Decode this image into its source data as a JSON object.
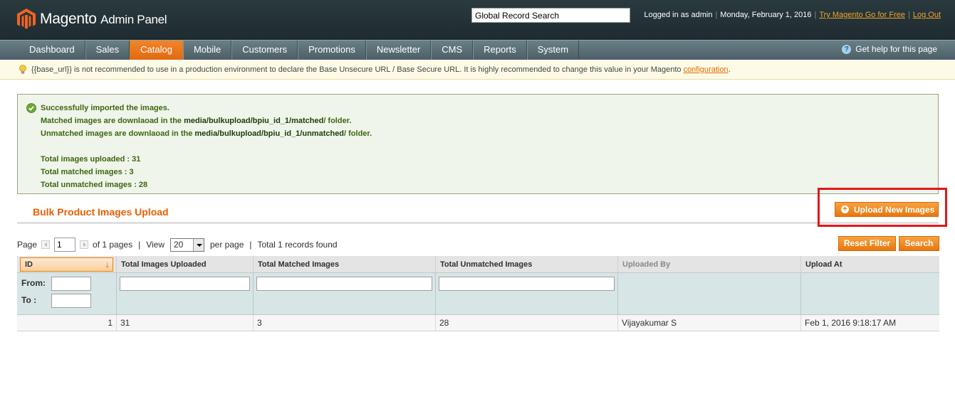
{
  "header": {
    "logo_main": "Magento",
    "logo_sub": "Admin Panel",
    "global_search_value": "Global Record Search",
    "logged_in": "Logged in as admin",
    "date": "Monday, February 1, 2016",
    "try_link": "Try Magento Go for Free",
    "logout_link": "Log Out"
  },
  "nav": {
    "items": [
      "Dashboard",
      "Sales",
      "Catalog",
      "Mobile",
      "Customers",
      "Promotions",
      "Newsletter",
      "CMS",
      "Reports",
      "System"
    ],
    "active": "Catalog",
    "help": "Get help for this page"
  },
  "notice": {
    "text": "{{base_url}} is not recommended to use in a production environment to declare the Base Unsecure URL / Base Secure URL. It is highly recommended to change this value in your Magento ",
    "link": "configuration",
    "end": "."
  },
  "success": {
    "line1": "Successfully imported the images.",
    "line2_pre": "Matched images are downlaoad in the ",
    "line2_path": "media/bulkupload/bpiu_id_1/matched",
    "line2_post": "/ folder.",
    "line3_pre": "Unmatched images are downlaoad in the ",
    "line3_path": "media/bulkupload/bpiu_id_1/unmatched",
    "line3_post": "/ folder.",
    "total_uploaded": "Total images uploaded : 31",
    "total_matched": "Total matched images : 3",
    "total_unmatched": "Total unmatched images : 28"
  },
  "page": {
    "title": "Bulk Product Images Upload",
    "upload_button": "Upload New Images"
  },
  "pager": {
    "page_label": "Page",
    "page_value": "1",
    "of_pages": "of 1 pages",
    "view_label": "View",
    "view_value": "20",
    "per_page": "per page",
    "total": "Total 1 records found",
    "reset_filter": "Reset Filter",
    "search": "Search"
  },
  "grid": {
    "columns": [
      "ID",
      "Total Images Uploaded",
      "Total Matched Images",
      "Total Unmatched Images",
      "Uploaded By",
      "Upload At"
    ],
    "from_label": "From:",
    "to_label": "To :",
    "rows": [
      [
        "1",
        "31",
        "3",
        "28",
        "Vijayakumar S",
        "Feb 1, 2016 9:18:17 AM"
      ]
    ]
  },
  "colors": {
    "accent": "#eb5e00",
    "header_bg": "#2a3a3f",
    "success_text": "#3d6611",
    "highlight": "#e4151c"
  }
}
